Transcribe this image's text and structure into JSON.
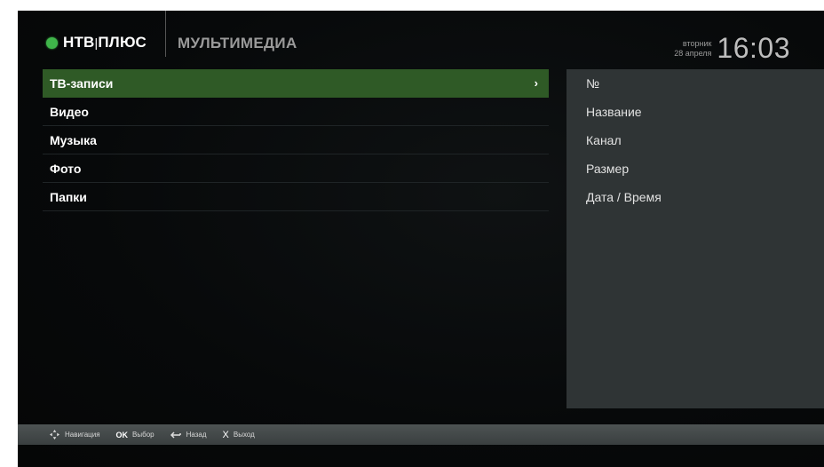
{
  "header": {
    "logo_text": "НТВ",
    "logo_sep": "|",
    "logo_text2": "ПЛЮС",
    "section_title": "МУЛЬТИМЕДИА",
    "weekday": "вторник",
    "date": "28 апреля",
    "time": "16:03"
  },
  "menu": {
    "items": [
      {
        "label": "ТВ-записи",
        "active": true
      },
      {
        "label": "Видео"
      },
      {
        "label": "Музыка"
      },
      {
        "label": "Фото"
      },
      {
        "label": "Папки"
      }
    ],
    "chevron": "›"
  },
  "detail": {
    "items": [
      "№",
      "Название",
      "Канал",
      "Размер",
      "Дата / Время"
    ]
  },
  "footer": {
    "hints": [
      {
        "icon": "dpad-icon",
        "label": "Навигация"
      },
      {
        "key": "OK",
        "label": "Выбор"
      },
      {
        "icon": "back-arrow-icon",
        "label": "Назад"
      },
      {
        "key": "X",
        "label": "Выход"
      }
    ]
  },
  "colors": {
    "accent_green": "#2f5a26",
    "logo_dot": "#3fb54a",
    "panel_bg": "#2f3435"
  }
}
